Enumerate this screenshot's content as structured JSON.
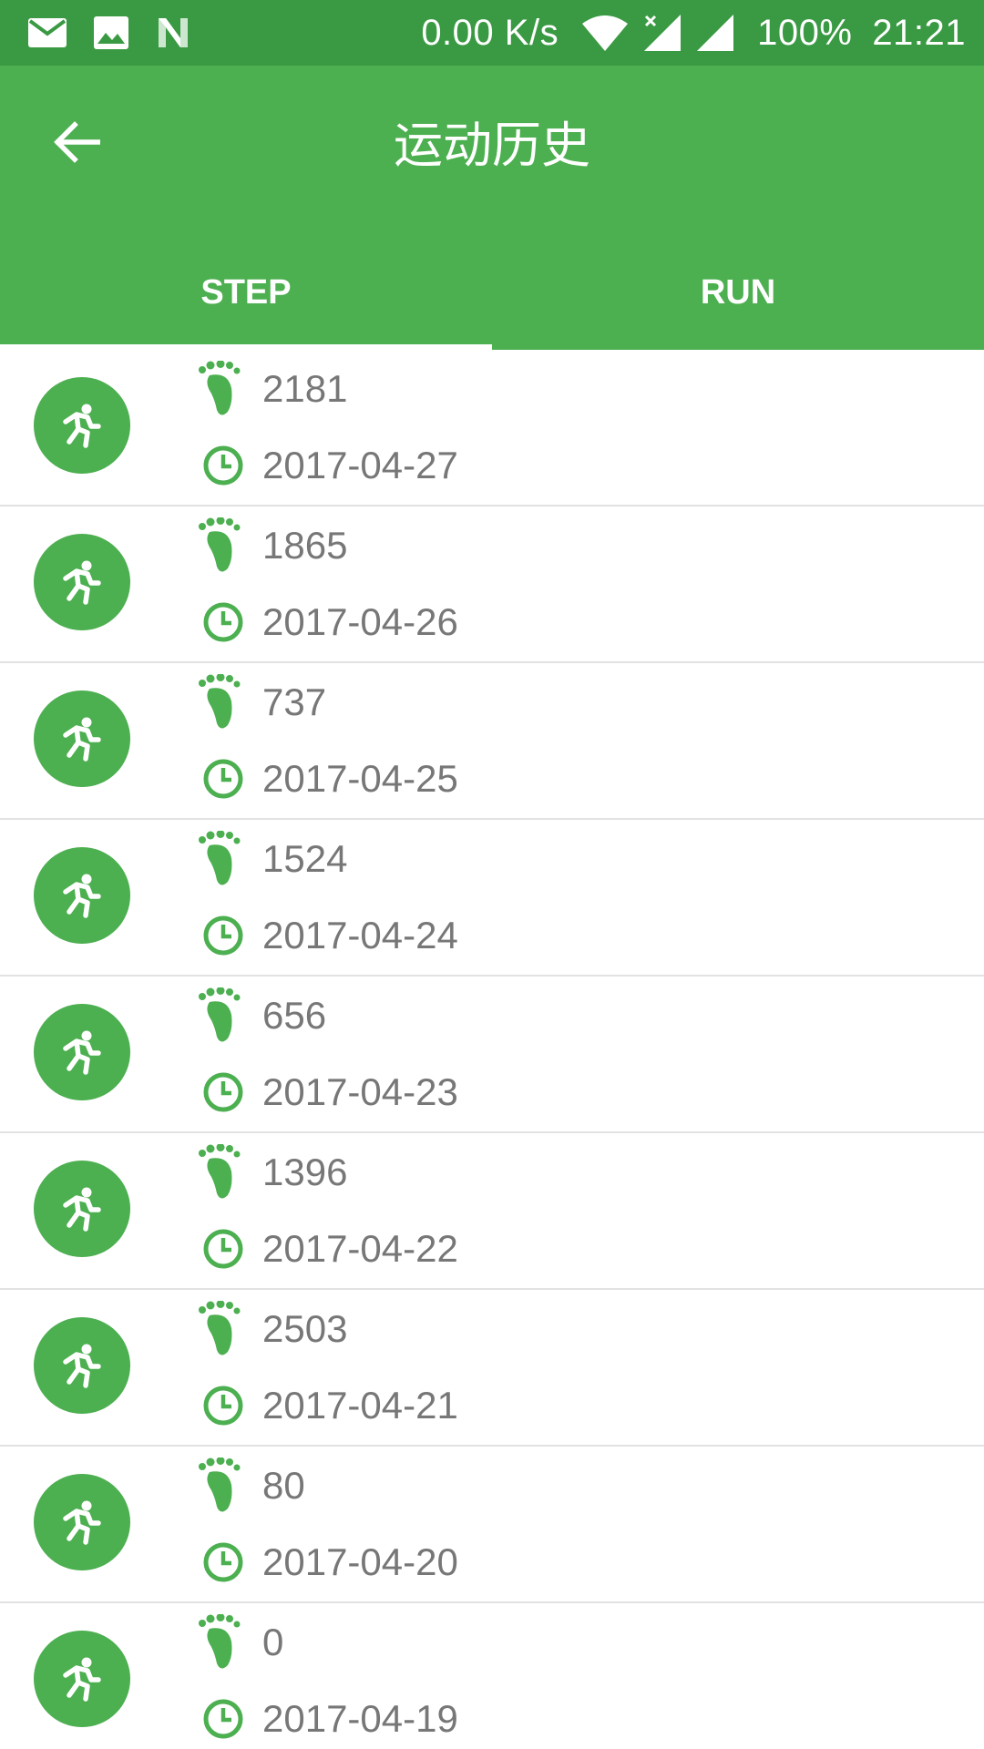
{
  "status_bar": {
    "speed": "0.00 K/s",
    "battery": "100%",
    "time": "21:21"
  },
  "app_bar": {
    "title": "运动历史"
  },
  "tabs": [
    {
      "label": "STEP",
      "active": true
    },
    {
      "label": "RUN",
      "active": false
    }
  ],
  "colors": {
    "primary": "#4caf50",
    "status_bar": "#3a9a43",
    "text_secondary": "#777777",
    "divider": "#e2e2e2"
  },
  "records": [
    {
      "steps": "2181",
      "date": "2017-04-27"
    },
    {
      "steps": "1865",
      "date": "2017-04-26"
    },
    {
      "steps": "737",
      "date": "2017-04-25"
    },
    {
      "steps": "1524",
      "date": "2017-04-24"
    },
    {
      "steps": "656",
      "date": "2017-04-23"
    },
    {
      "steps": "1396",
      "date": "2017-04-22"
    },
    {
      "steps": "2503",
      "date": "2017-04-21"
    },
    {
      "steps": "80",
      "date": "2017-04-20"
    },
    {
      "steps": "0",
      "date": "2017-04-19"
    }
  ]
}
